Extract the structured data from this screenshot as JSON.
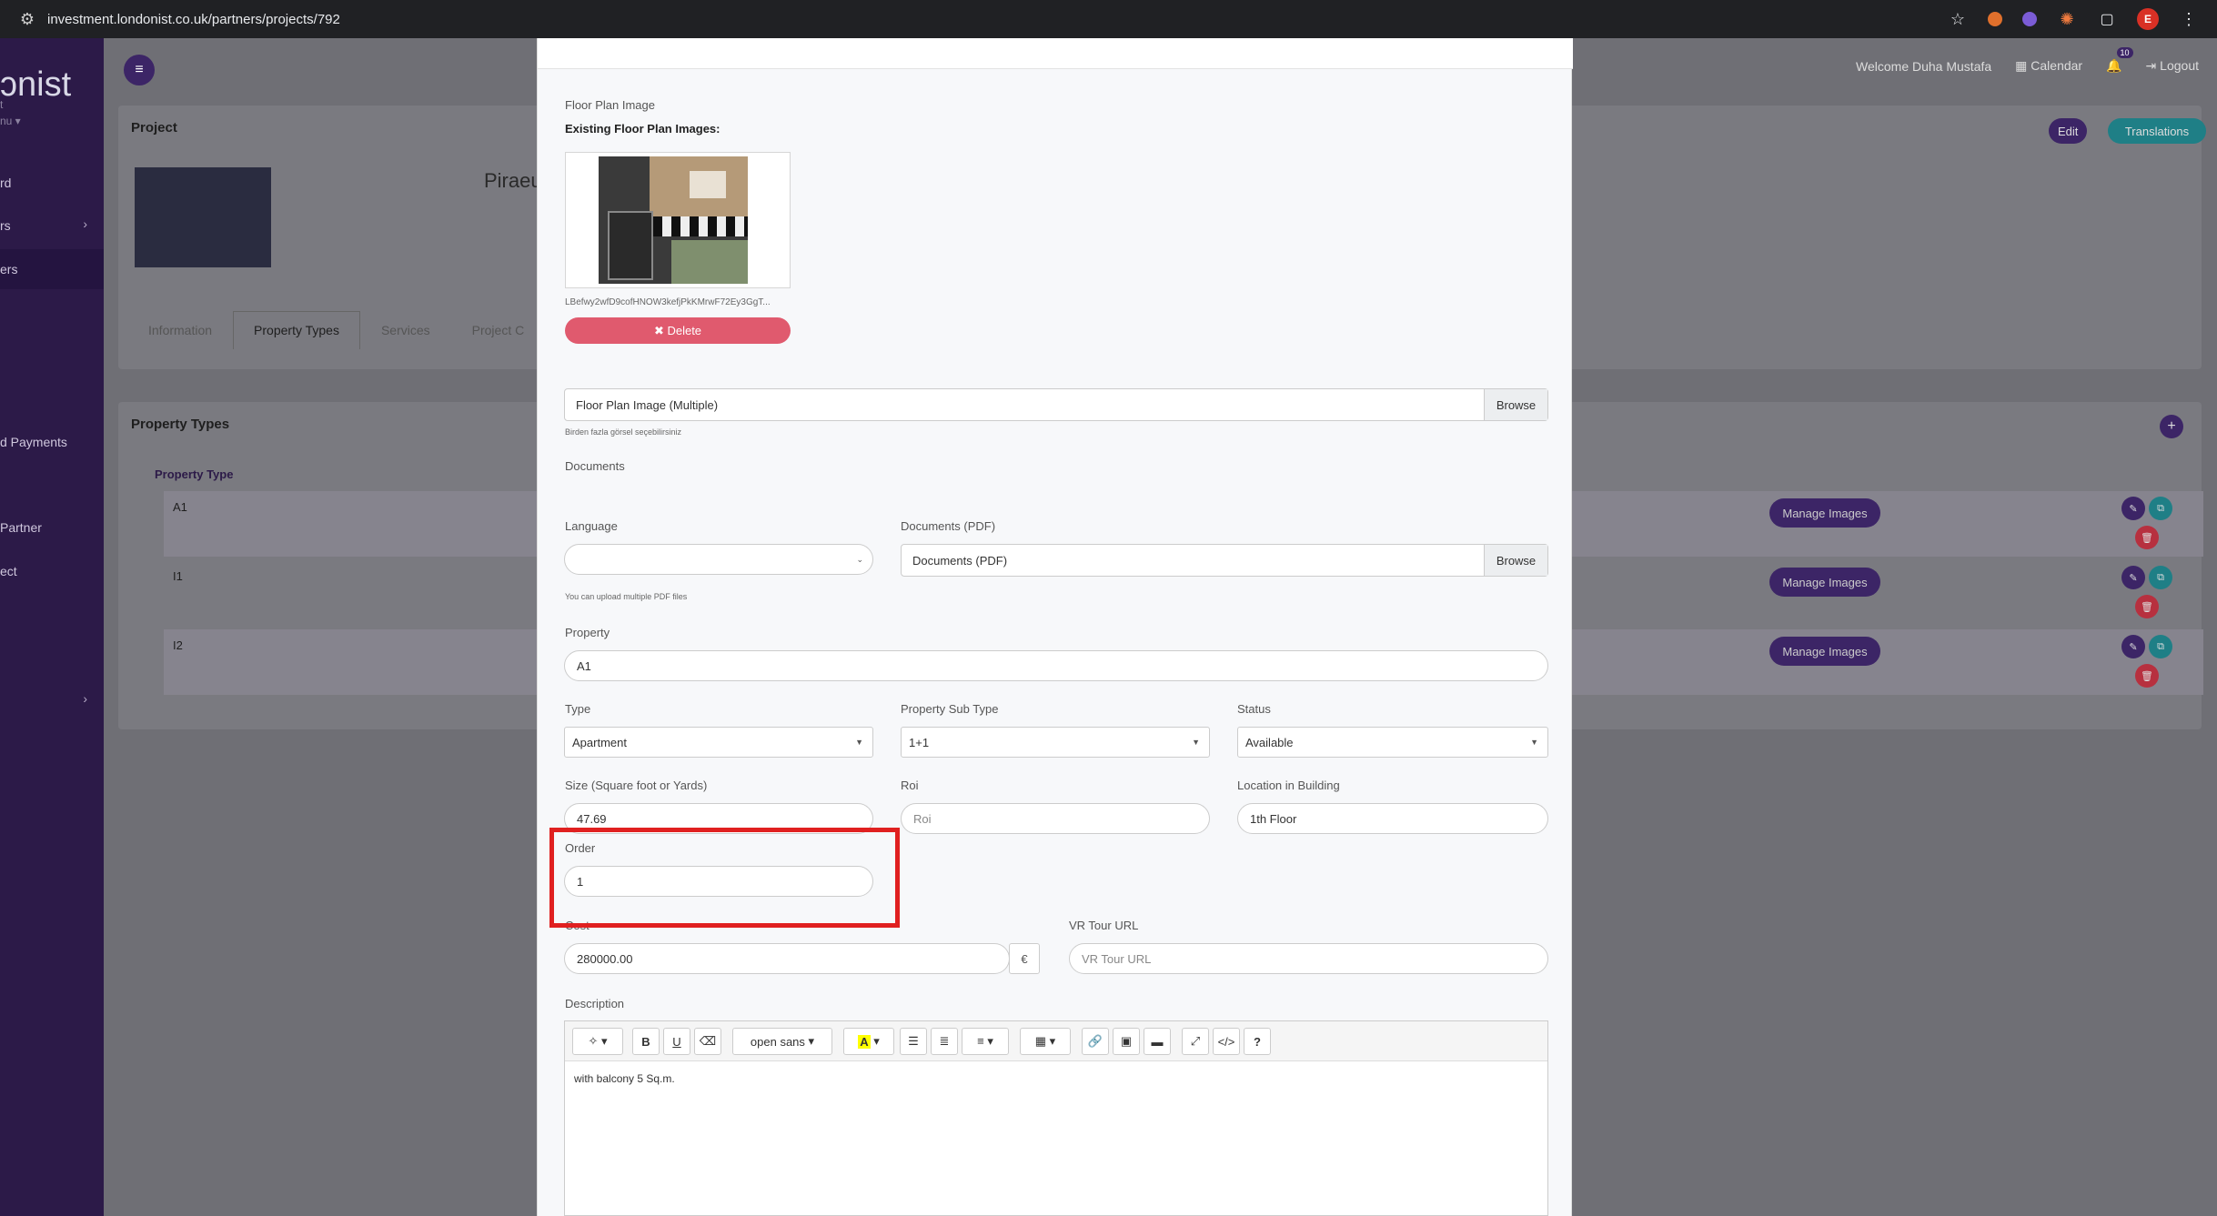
{
  "browser": {
    "url": "investment.londonist.co.uk/partners/projects/792",
    "avatar_letter": "E"
  },
  "sidebar": {
    "logo": "ɔnist",
    "logo_sub": "t",
    "menu_label": "nu ▾",
    "items": [
      "rd",
      "rs",
      "ers",
      "d Payments",
      "Partner",
      "ect"
    ]
  },
  "header": {
    "welcome": "Welcome Duha Mustafa",
    "calendar": "Calendar",
    "notif_count": "10",
    "logout": "Logout"
  },
  "project": {
    "title": "Project",
    "name_partial": "Piraeus",
    "edit": "Edit",
    "translations": "Translations",
    "tabs": [
      "Information",
      "Property Types",
      "Services",
      "Project C"
    ]
  },
  "property_types": {
    "title": "Property Types",
    "column": "Property Type",
    "rows": [
      "A1",
      "I1",
      "I2"
    ],
    "manage_label": "Manage Images"
  },
  "modal": {
    "floor_plan_label": "Floor Plan Image",
    "existing_label": "Existing Floor Plan Images:",
    "file_name": "LBefwy2wfD9cofHNOW3kefjPkKMrwF72Ey3GgT...",
    "delete_label": "✖ Delete",
    "floor_plan_multi": "Floor Plan Image (Multiple)",
    "browse": "Browse",
    "floor_plan_help": "Birden fazla görsel seçebilirsiniz",
    "documents_label": "Documents",
    "language_label": "Language",
    "documents_pdf_label": "Documents (PDF)",
    "documents_pdf_value": "Documents (PDF)",
    "pdf_help": "You can upload multiple PDF files",
    "property_label": "Property",
    "property_value": "A1",
    "type_label": "Type",
    "type_value": "Apartment",
    "subtype_label": "Property Sub Type",
    "subtype_value": "1+1",
    "status_label": "Status",
    "status_value": "Available",
    "size_label": "Size (Square foot or Yards)",
    "size_value": "47.69",
    "roi_label": "Roi",
    "roi_placeholder": "Roi",
    "location_label": "Location in Building",
    "location_value": "1th Floor",
    "order_label": "Order",
    "order_value": "1",
    "cost_label": "Cost",
    "cost_value": "280000.00",
    "currency": "€",
    "vr_label": "VR Tour URL",
    "vr_placeholder": "VR Tour URL",
    "description_label": "Description",
    "font_name": "open sans",
    "description_text": "with balcony 5 Sq.m."
  },
  "colors": {
    "highlight": "#e02020",
    "primary": "#3c2566",
    "delete": "#e05a6e"
  }
}
